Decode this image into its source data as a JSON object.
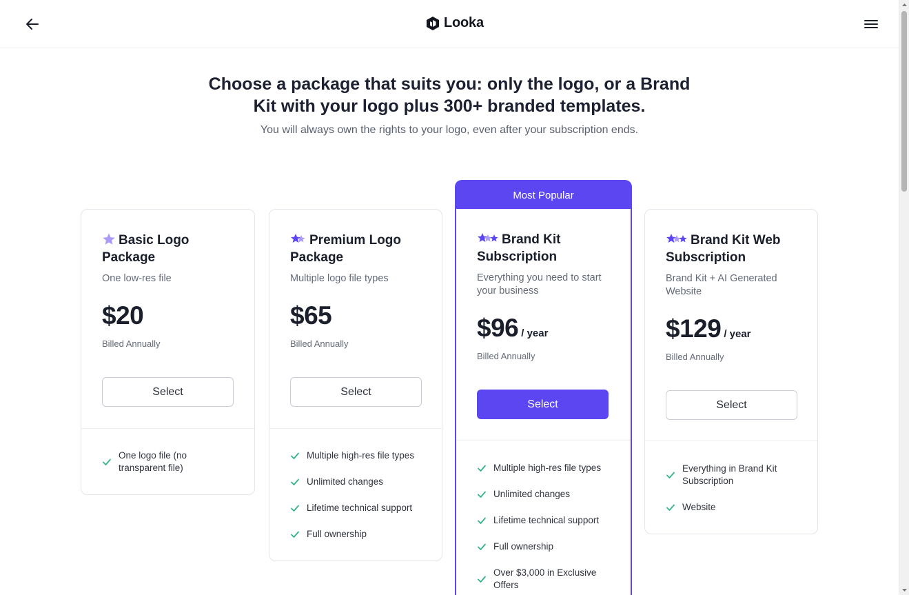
{
  "header": {
    "back_icon": "arrow-left-icon",
    "brand_name": "Looka",
    "menu_icon": "hamburger-menu-icon"
  },
  "hero": {
    "title_line1": "Choose a package that suits you: only the logo, or a Brand",
    "title_line2": "Kit with your logo plus 300+ branded templates.",
    "subtitle": "You will always own the rights to your logo, even after your subscription ends."
  },
  "colors": {
    "accent": "#5b46f2",
    "star_light": "#a99bf7",
    "check": "#34b38a"
  },
  "plans": [
    {
      "title_line1": "Basic Logo",
      "title_line2": "Package",
      "stars": 1,
      "desc_line1": "One low-res file",
      "desc_line2": "",
      "price": "$20",
      "period": "",
      "billed": "Billed Annually",
      "select_label": "Select",
      "features": [
        {
          "line1": "One logo file (no",
          "line2": "transparent file)"
        }
      ]
    },
    {
      "title_line1": "Premium Logo",
      "title_line2": "Package",
      "stars": 2,
      "desc_line1": "Multiple logo file types",
      "desc_line2": "",
      "price": "$65",
      "period": "",
      "billed": "Billed Annually",
      "select_label": "Select",
      "features": [
        {
          "line1": "Multiple high-res file types",
          "line2": ""
        },
        {
          "line1": "Unlimited changes",
          "line2": ""
        },
        {
          "line1": "Lifetime technical support",
          "line2": ""
        },
        {
          "line1": "Full ownership",
          "line2": ""
        }
      ]
    },
    {
      "badge": "Most Popular",
      "title_line1": "Brand Kit",
      "title_line2": "Subscription",
      "stars": 3,
      "desc_line1": "Everything you need to start",
      "desc_line2": "your business",
      "price": "$96",
      "period": "/ year",
      "billed": "Billed Annually",
      "select_label": "Select",
      "features": [
        {
          "line1": "Multiple high-res file types",
          "line2": ""
        },
        {
          "line1": "Unlimited changes",
          "line2": ""
        },
        {
          "line1": "Lifetime technical support",
          "line2": ""
        },
        {
          "line1": "Full ownership",
          "line2": ""
        },
        {
          "line1": "Over $3,000 in Exclusive",
          "line2": "Offers"
        }
      ]
    },
    {
      "title_line1": "Brand Kit Web",
      "title_line2": "Subscription",
      "stars": 3,
      "desc_line1": "Brand Kit + AI Generated",
      "desc_line2": "Website",
      "price": "$129",
      "period": "/ year",
      "billed": "Billed Annually",
      "select_label": "Select",
      "features": [
        {
          "line1": "Everything in Brand Kit",
          "line2": "Subscription"
        },
        {
          "line1": "Website",
          "line2": ""
        }
      ]
    }
  ]
}
